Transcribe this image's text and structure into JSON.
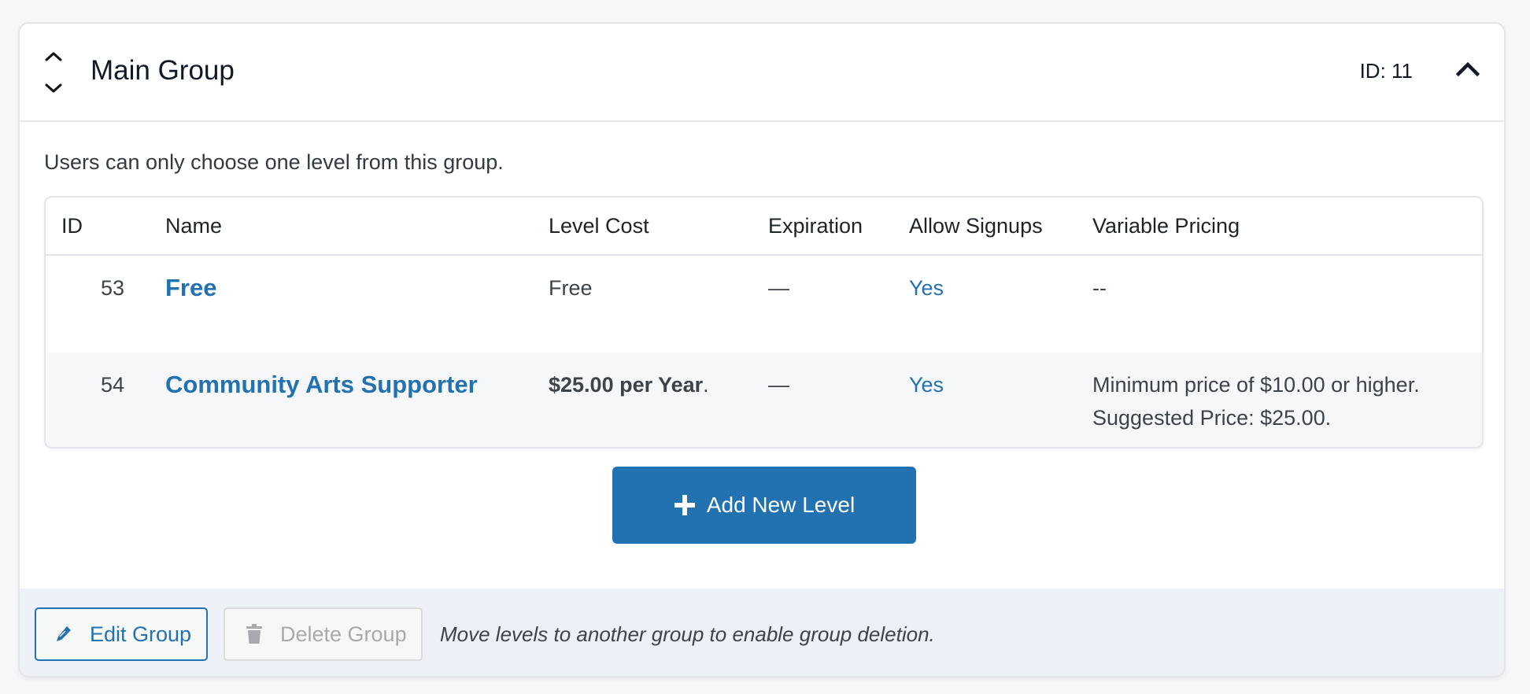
{
  "group": {
    "title": "Main Group",
    "id_label": "ID: 11",
    "description": "Users can only choose one level from this group."
  },
  "table": {
    "headers": [
      "ID",
      "Name",
      "Level Cost",
      "Expiration",
      "Allow Signups",
      "Variable Pricing"
    ],
    "rows": [
      {
        "id": "53",
        "name": "Free",
        "cost": "Free",
        "expiration": "—",
        "allow_signups": "Yes",
        "variable_pricing": "--"
      },
      {
        "id": "54",
        "name": "Community Arts Supporter",
        "cost": "$25.00 per Year",
        "cost_suffix": ".",
        "expiration": "—",
        "allow_signups": "Yes",
        "variable_pricing_line1": "Minimum price of $10.00 or higher.",
        "variable_pricing_line2": "Suggested Price: $25.00."
      }
    ]
  },
  "actions": {
    "add_level_label": "Add New Level",
    "edit_group_label": "Edit Group",
    "delete_group_label": "Delete Group",
    "delete_disabled_message": "Move levels to another group to enable group deletion."
  },
  "colors": {
    "accent": "#2271b1",
    "footer_bg": "#edf0f7",
    "alt_row_bg": "#f6f7f9"
  },
  "icons": {
    "sort": "sort-up-down-icon",
    "collapse": "chevron-up-icon",
    "add": "plus-icon",
    "edit": "pencil-icon",
    "delete": "trash-icon"
  }
}
